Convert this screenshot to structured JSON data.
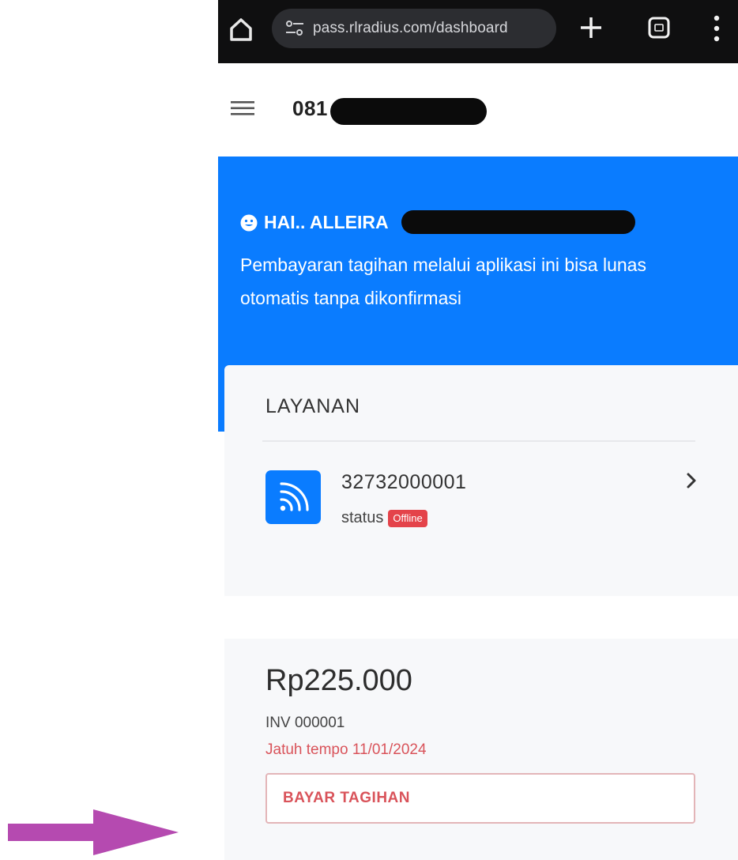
{
  "browser": {
    "url": "pass.rlradius.com/dashboard"
  },
  "header": {
    "phone_prefix": "081"
  },
  "hero": {
    "greeting": "HAI.. ALLEIRA",
    "message": "Pembayaran tagihan melalui aplikasi ini bisa lunas otomatis tanpa dikonfirmasi"
  },
  "layanan": {
    "title": "LAYANAN",
    "service_id": "32732000001",
    "status_label": "status",
    "status_value": "Offline"
  },
  "invoice": {
    "amount": "Rp225.000",
    "number": "INV 000001",
    "due": "Jatuh tempo 11/01/2024",
    "pay_label": "BAYAR TAGIHAN"
  },
  "colors": {
    "primary_blue": "#0a7cff",
    "danger_red": "#e4434a",
    "arrow_purple": "#b54ab0"
  },
  "icons": [
    "home-icon",
    "tune-icon",
    "new-tab-icon",
    "tabs-icon",
    "more-vert-icon",
    "hamburger-icon",
    "smile-icon",
    "wifi-icon",
    "chevron-right-icon",
    "arrow-right-icon"
  ]
}
